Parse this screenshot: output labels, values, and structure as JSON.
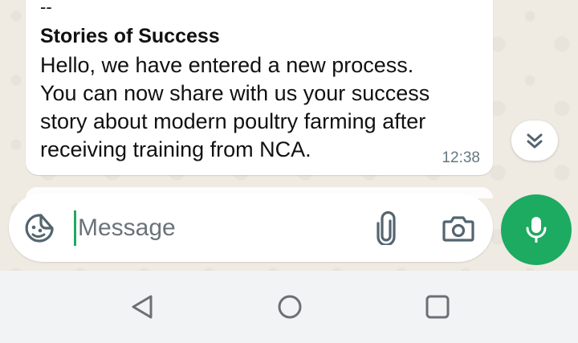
{
  "message": {
    "dash": "--",
    "title": "Stories of Success",
    "body_lines": [
      "Hello, we have entered a new process.",
      "You can now share with us your success",
      "story about modern poultry farming after",
      "receiving training from NCA."
    ],
    "time": "12:38"
  },
  "input_bar": {
    "placeholder": "Message",
    "emoji_icon": "sticker-icon",
    "attach_icon": "paperclip-icon",
    "camera_icon": "camera-icon"
  },
  "mic_button": {
    "icon": "microphone-icon",
    "color": "#1daa61"
  },
  "scroll_button": {
    "icon": "double-chevron-down-icon"
  },
  "nav": {
    "back_icon": "triangle-back-icon",
    "home_icon": "circle-home-icon",
    "recent_icon": "square-recents-icon"
  },
  "colors": {
    "accent": "#1daa61",
    "chat_bg": "#efeae2",
    "time_text": "#667781"
  }
}
